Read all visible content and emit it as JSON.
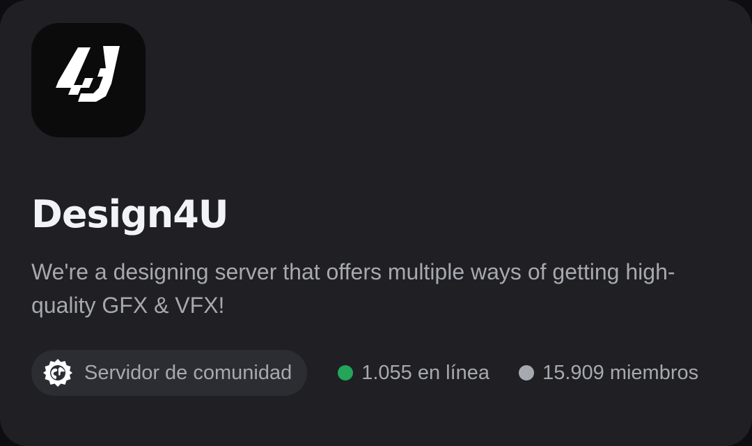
{
  "server": {
    "name": "Design4U",
    "logo_text": "4J",
    "description": "We're a designing server that offers multiple ways of getting high-quality GFX & VFX!",
    "community_label": "Servidor de comunidad",
    "online_text": "1.055 en línea",
    "members_text": "15.909 miembros"
  },
  "colors": {
    "background": "#1f1f24",
    "online_dot": "#23a55a",
    "members_dot": "#a7a9b0",
    "pill_background": "#2b2d33"
  },
  "icons": {
    "community": "community-badge-icon"
  }
}
